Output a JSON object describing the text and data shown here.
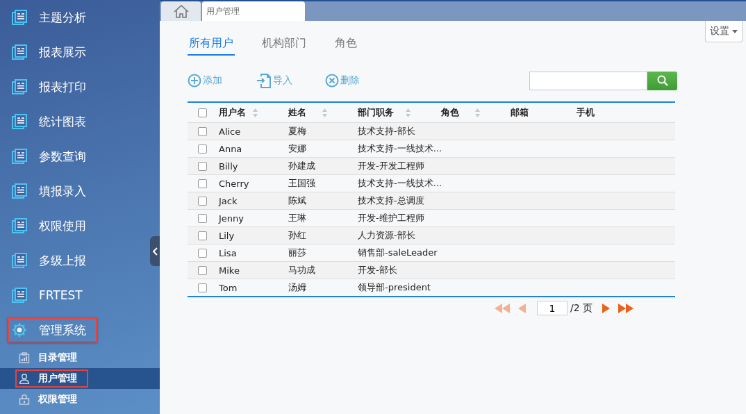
{
  "sidebar": {
    "items": [
      {
        "label": "主题分析",
        "kind": "report",
        "highlighted": false
      },
      {
        "label": "报表展示",
        "kind": "report",
        "highlighted": false
      },
      {
        "label": "报表打印",
        "kind": "report",
        "highlighted": false
      },
      {
        "label": "统计图表",
        "kind": "report",
        "highlighted": false
      },
      {
        "label": "参数查询",
        "kind": "report",
        "highlighted": false
      },
      {
        "label": "填报录入",
        "kind": "report",
        "highlighted": false
      },
      {
        "label": "权限使用",
        "kind": "report",
        "highlighted": false
      },
      {
        "label": "多级上报",
        "kind": "report",
        "highlighted": false
      },
      {
        "label": "FRTEST",
        "kind": "report",
        "highlighted": false
      },
      {
        "label": "管理系统",
        "kind": "system",
        "highlighted": true,
        "children": [
          {
            "label": "目录管理",
            "kind": "catalog",
            "selected": false,
            "highlighted": false
          },
          {
            "label": "用户管理",
            "kind": "user",
            "selected": true,
            "highlighted": true
          },
          {
            "label": "权限管理",
            "kind": "lock",
            "selected": false,
            "highlighted": false
          }
        ]
      }
    ]
  },
  "page_tabs": [
    {
      "label": "用户管理",
      "selected": true
    }
  ],
  "settings": {
    "label": "设置"
  },
  "tabs": [
    {
      "label": "所有用户",
      "selected": true
    },
    {
      "label": "机构部门",
      "selected": false
    },
    {
      "label": "角色",
      "selected": false
    }
  ],
  "toolbar": [
    {
      "label": "添加",
      "kind": "add"
    },
    {
      "label": "导入",
      "kind": "import"
    },
    {
      "label": "删除",
      "kind": "delete"
    }
  ],
  "table": {
    "header_checked": false,
    "columns": [
      {
        "label": "用户名",
        "sortable": true
      },
      {
        "label": "姓名",
        "sortable": true
      },
      {
        "label": "部门职务",
        "sortable": true
      },
      {
        "label": "角色",
        "sortable": true
      },
      {
        "label": "邮箱",
        "sortable": false
      },
      {
        "label": "手机",
        "sortable": false
      }
    ],
    "rows": [
      {
        "checked": false,
        "cells": [
          "Alice",
          "夏梅",
          "技术支持-部长"
        ]
      },
      {
        "checked": false,
        "cells": [
          "Anna",
          "安娜",
          "技术支持-一线技术..."
        ]
      },
      {
        "checked": false,
        "cells": [
          "Billy",
          "孙建成",
          "开发-开发工程师"
        ]
      },
      {
        "checked": false,
        "cells": [
          "Cherry",
          "王国强",
          "技术支持-一线技术..."
        ]
      },
      {
        "checked": false,
        "cells": [
          "Jack",
          "陈斌",
          "技术支持-总调度"
        ]
      },
      {
        "checked": false,
        "cells": [
          "Jenny",
          "王琳",
          "开发-维护工程师"
        ]
      },
      {
        "checked": false,
        "cells": [
          "Lily",
          "孙红",
          "人力资源-部长"
        ]
      },
      {
        "checked": false,
        "cells": [
          "Lisa",
          "丽莎",
          "销售部-saleLeader"
        ]
      },
      {
        "checked": false,
        "cells": [
          "Mike",
          "马功成",
          "开发-部长"
        ]
      },
      {
        "checked": false,
        "cells": [
          "Tom",
          "汤姆",
          "领导部-president"
        ]
      }
    ]
  },
  "pagination": {
    "first_disabled": true,
    "prev_disabled": true,
    "next_disabled": false,
    "last_disabled": false,
    "page": "1",
    "total": "/2 页"
  }
}
